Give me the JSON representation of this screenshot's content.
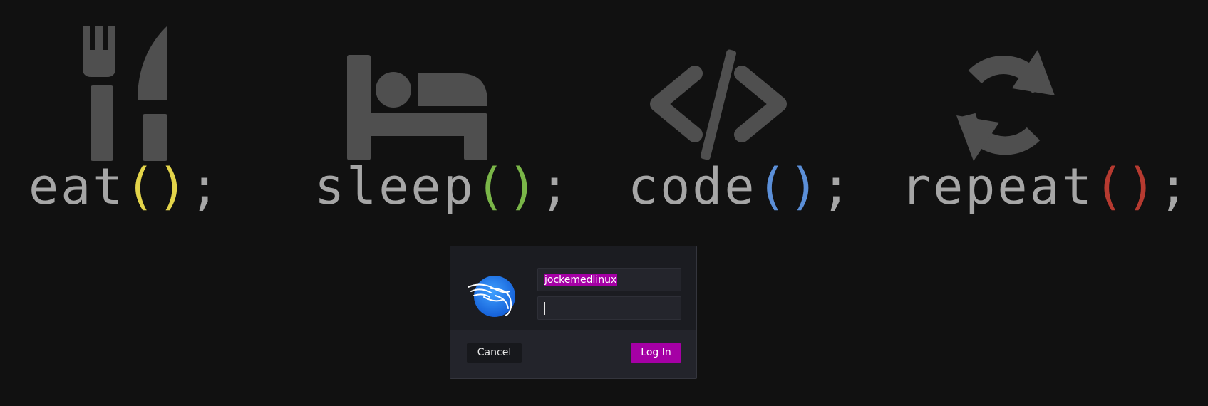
{
  "wallpaper": {
    "icons": [
      "fork-knife-icon",
      "bed-icon",
      "code-brackets-icon",
      "repeat-arrows-icon"
    ],
    "icon_color": "#4f4f4f",
    "text_color": "#a6a6a6",
    "mottos": [
      {
        "word": "eat",
        "open": "(",
        "close": ")",
        "end": ";",
        "paren_color": "#e3d44a"
      },
      {
        "word": "sleep",
        "open": "(",
        "close": ")",
        "end": ";",
        "paren_color": "#7ab648"
      },
      {
        "word": "code",
        "open": "(",
        "close": ")",
        "end": ";",
        "paren_color": "#5b8fd8"
      },
      {
        "word": "repeat",
        "open": "(",
        "close": ")",
        "end": ";",
        "paren_color": "#b63a30"
      }
    ]
  },
  "login": {
    "avatar_icon": "kali-dragon-icon",
    "username_value": "jockemedlinux",
    "password_value": "",
    "cancel_label": "Cancel",
    "login_label": "Log In",
    "accent_color": "#a500a5"
  }
}
